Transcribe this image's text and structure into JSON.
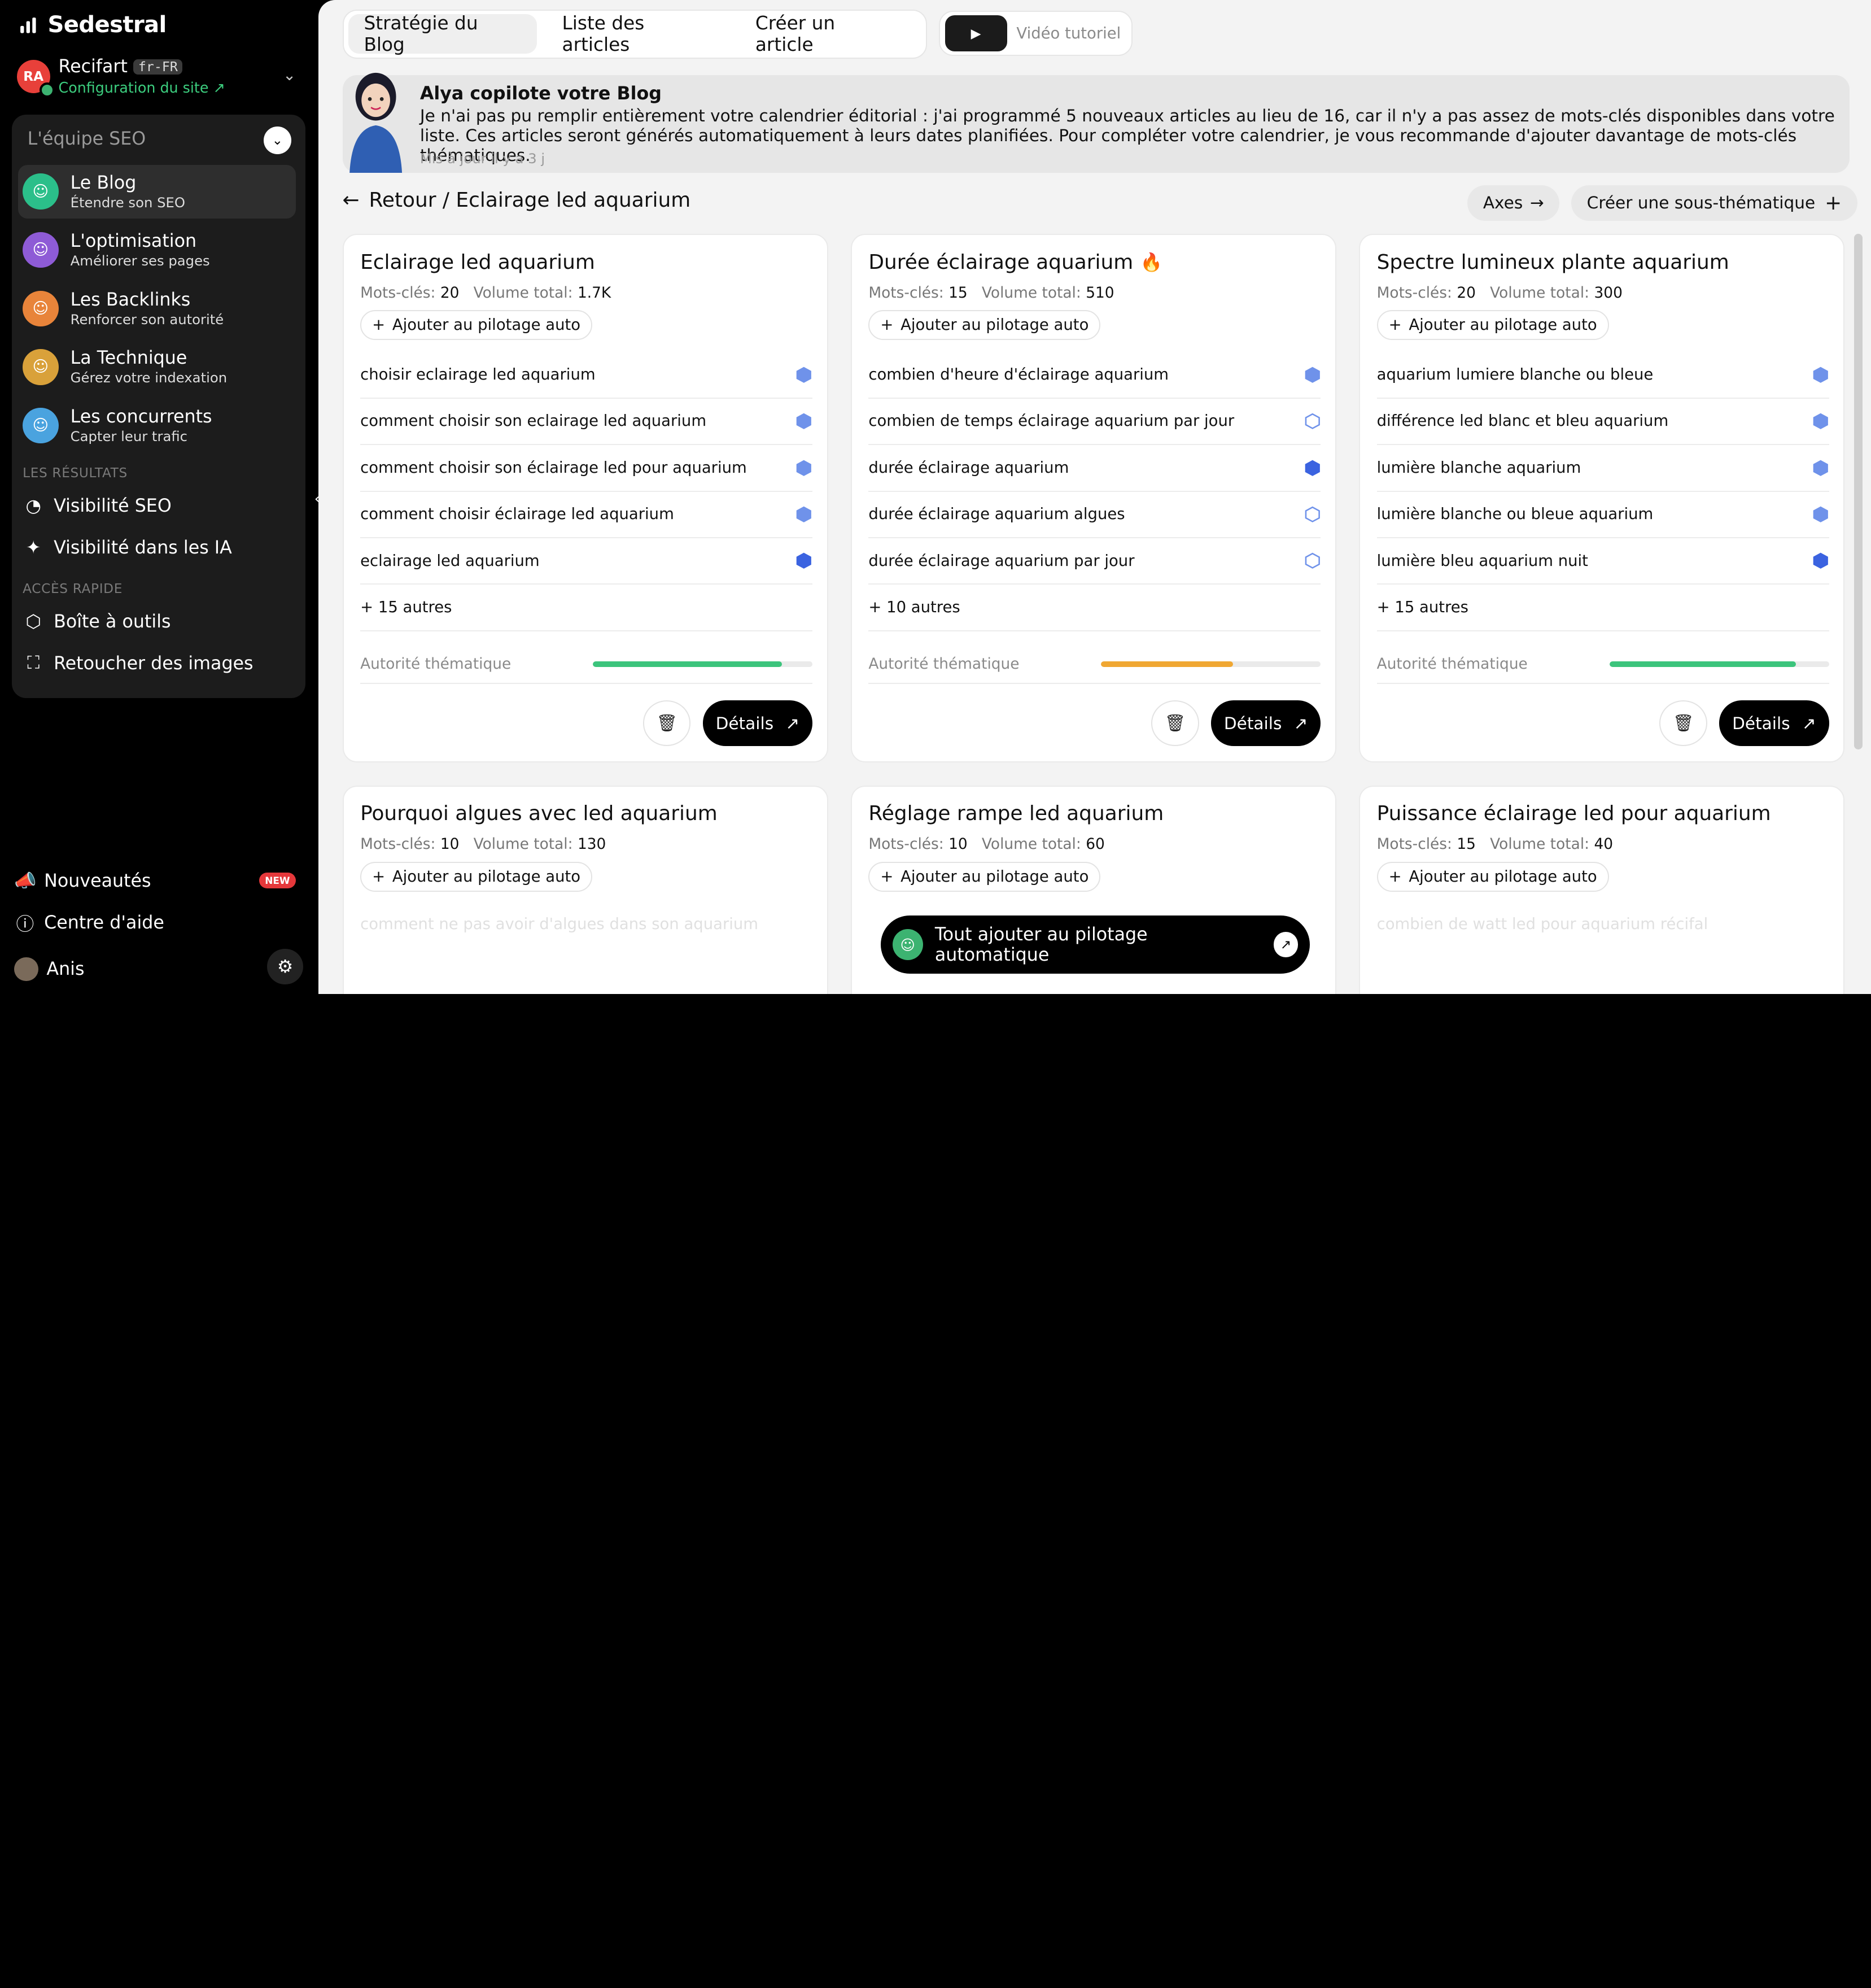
{
  "brand": {
    "name": "Sedestral"
  },
  "site": {
    "avatar_text": "RA",
    "name": "Recifart",
    "lang": "fr-FR",
    "config_link": "Configuration du site ↗"
  },
  "team": {
    "header": "L'équipe SEO",
    "agents": [
      {
        "title": "Le Blog",
        "subtitle": "Étendre son SEO",
        "color": "#2bbf8a"
      },
      {
        "title": "L'optimisation",
        "subtitle": "Améliorer ses pages",
        "color": "#8e5bd6"
      },
      {
        "title": "Les Backlinks",
        "subtitle": "Renforcer son autorité",
        "color": "#e8843a"
      },
      {
        "title": "La Technique",
        "subtitle": "Gérez votre indexation",
        "color": "#d9a13a"
      },
      {
        "title": "Les concurrents",
        "subtitle": "Capter leur trafic",
        "color": "#4aa3df"
      }
    ],
    "results_label": "LES RÉSULTATS",
    "results": [
      {
        "label": "Visibilité SEO",
        "icon": "pie-chart-icon"
      },
      {
        "label": "Visibilité dans les IA",
        "icon": "sparkle-icon"
      }
    ],
    "quick_label": "ACCÈS RAPIDE",
    "quick": [
      {
        "label": "Boîte à outils",
        "icon": "box-icon"
      },
      {
        "label": "Retoucher des images",
        "icon": "image-edit-icon"
      }
    ]
  },
  "bottom": {
    "news": "Nouveautés",
    "news_badge": "NEW",
    "help": "Centre d'aide",
    "user": "Anis"
  },
  "tabs": [
    {
      "label": "Stratégie du Blog",
      "active": true
    },
    {
      "label": "Liste des articles",
      "active": false
    },
    {
      "label": "Créer un article",
      "active": false
    }
  ],
  "video": {
    "label": "Vidéo tutoriel"
  },
  "copilot": {
    "title": "Alya copilote votre Blog",
    "message": "Je n'ai pas pu remplir entièrement votre calendrier éditorial : j'ai programmé 5 nouveaux articles au lieu de 16, car il n'y a pas assez de mots-clés disponibles dans votre liste. Ces articles seront générés automatiquement à leurs dates planifiées. Pour compléter votre calendrier, je vous recommande d'ajouter davantage de mots-clés thématiques.",
    "updated": "Mis à jour il y a 3 j"
  },
  "breadcrumb": {
    "text": "Retour / Eclairage led aquarium"
  },
  "actions": {
    "axes": "Axes",
    "create_sub": "Créer une sous-thématique"
  },
  "labels": {
    "keywords": "Mots-clés:",
    "volume": "Volume total:",
    "auto": "Ajouter au pilotage auto",
    "authority": "Autorité thématique",
    "details": "Détails"
  },
  "cards": [
    {
      "title": "Eclairage led aquarium",
      "hot": false,
      "keywords": "20",
      "volume": "1.7K",
      "items": [
        {
          "text": "choisir eclairage led aquarium",
          "state": "mid"
        },
        {
          "text": "comment choisir son eclairage led aquarium",
          "state": "mid"
        },
        {
          "text": "comment choisir son éclairage led pour aquarium",
          "state": "mid"
        },
        {
          "text": "comment choisir éclairage led aquarium",
          "state": "mid"
        },
        {
          "text": "eclairage led aquarium",
          "state": "full"
        }
      ],
      "more": "+ 15 autres",
      "authority": 0.86,
      "authority_color": "#3cc47c"
    },
    {
      "title": "Durée éclairage aquarium",
      "hot": true,
      "keywords": "15",
      "volume": "510",
      "items": [
        {
          "text": "combien d'heure d'éclairage aquarium",
          "state": "mid"
        },
        {
          "text": "combien de temps éclairage aquarium par jour",
          "state": "empty"
        },
        {
          "text": "durée éclairage aquarium",
          "state": "full"
        },
        {
          "text": "durée éclairage aquarium algues",
          "state": "empty"
        },
        {
          "text": "durée éclairage aquarium par jour",
          "state": "empty"
        }
      ],
      "more": "+ 10 autres",
      "authority": 0.6,
      "authority_color": "#f0a732"
    },
    {
      "title": "Spectre lumineux plante aquarium",
      "hot": false,
      "keywords": "20",
      "volume": "300",
      "items": [
        {
          "text": "aquarium lumiere blanche ou bleue",
          "state": "mid"
        },
        {
          "text": "différence led blanc et bleu aquarium",
          "state": "mid"
        },
        {
          "text": "lumière blanche aquarium",
          "state": "mid"
        },
        {
          "text": "lumière blanche ou bleue aquarium",
          "state": "mid"
        },
        {
          "text": "lumière bleu aquarium nuit",
          "state": "full"
        }
      ],
      "more": "+ 15 autres",
      "authority": 0.85,
      "authority_color": "#3cc47c"
    },
    {
      "title": "Pourquoi algues avec led aquarium",
      "keywords": "10",
      "volume": "130",
      "faded": "comment ne pas avoir d'algues dans son aquarium"
    },
    {
      "title": "Réglage rampe led aquarium",
      "keywords": "10",
      "volume": "60",
      "faded": ""
    },
    {
      "title": "Puissance éclairage led pour aquarium",
      "keywords": "15",
      "volume": "40",
      "faded": "combien de watt led pour aquarium récifal"
    }
  ],
  "fab": {
    "label": "Tout ajouter au pilotage automatique"
  }
}
